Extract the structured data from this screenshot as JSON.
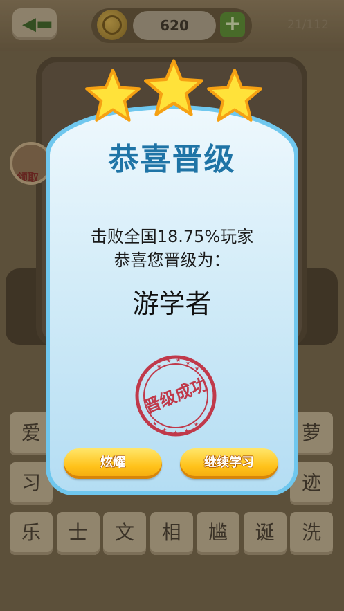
{
  "header": {
    "back_icon": "back-arrow-icon",
    "coin_icon": "coin-icon",
    "coins": "620",
    "add_icon": "plus-icon",
    "level_progress": "21/112"
  },
  "board": {
    "gift_label": "领取"
  },
  "tiles": [
    {
      "char": "爱",
      "row": 0,
      "col": 0
    },
    {
      "char": "萝",
      "row": 0,
      "col": 6
    },
    {
      "char": "习",
      "row": 1,
      "col": 0
    },
    {
      "char": "迹",
      "row": 1,
      "col": 6
    },
    {
      "char": "乐",
      "row": 2,
      "col": 0
    },
    {
      "char": "士",
      "row": 2,
      "col": 1
    },
    {
      "char": "文",
      "row": 2,
      "col": 2
    },
    {
      "char": "相",
      "row": 2,
      "col": 3
    },
    {
      "char": "尴",
      "row": 2,
      "col": 4
    },
    {
      "char": "诞",
      "row": 2,
      "col": 5
    },
    {
      "char": "洗",
      "row": 2,
      "col": 6
    }
  ],
  "dialog": {
    "stars_icon": "star-icon",
    "title": "恭喜晋级",
    "defeat_text": "击败全国18.75%玩家",
    "promote_text": "恭喜您晋级为：",
    "rank_name": "游学者",
    "stamp_text": "晋级成功",
    "share_button": "炫耀",
    "continue_button": "继续学习"
  },
  "colors": {
    "title": "#1f74a6",
    "dialog_border": "#6fc7ee",
    "button": "#ffc21a",
    "stamp": "#c0394a"
  }
}
